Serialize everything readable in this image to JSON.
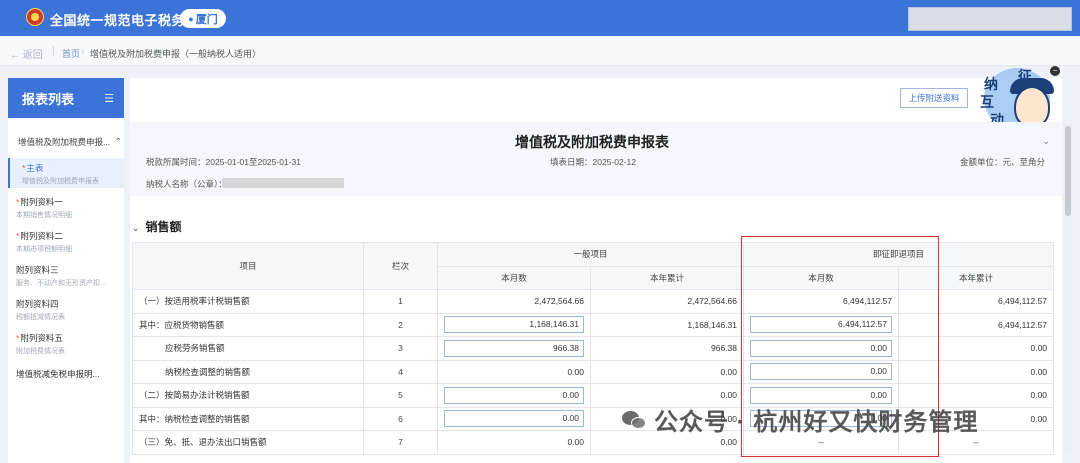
{
  "header": {
    "title": "全国统一规范电子税务局",
    "city": "厦门",
    "colors": {
      "brand": "#3b73d8",
      "highlight_border": "#d93636"
    }
  },
  "breadcrumb": {
    "back": "返回",
    "home": "首页",
    "current": "增值税及附加税费申报（一般纳税人适用）"
  },
  "sidebar": {
    "title": "报表列表",
    "group": "增值税及附加税费申报...",
    "items": [
      {
        "label": "主表",
        "sub": "增值税及附加税费申报表",
        "required": true,
        "active": true
      },
      {
        "label": "附列资料一",
        "sub": "本期销售情况明细",
        "required": true
      },
      {
        "label": "附列资料二",
        "sub": "本期进项税额明细",
        "required": true
      },
      {
        "label": "附列资料三",
        "sub": "服务、不动产和无形资产扣...",
        "required": false
      },
      {
        "label": "附列资料四",
        "sub": "税额抵减情况表",
        "required": false
      },
      {
        "label": "附列资料五",
        "sub": "附加税费情况表",
        "required": true
      },
      {
        "label": "增值税减免税申报明...",
        "sub": "",
        "required": false
      }
    ]
  },
  "main": {
    "upload_button": "上传附送资料",
    "mascot_text": [
      "征",
      "纳",
      "互",
      "动"
    ],
    "form_title": "增值税及附加税费申报表",
    "period_label": "税款所属时间：2025-01-01至2025-01-31",
    "fill_date_label": "填表日期：2025-02-12",
    "unit_label": "金额单位：元、至角分",
    "taxpayer_label": "纳税人名称（公章）：",
    "section_title": "销售额"
  },
  "table": {
    "headers": {
      "item": "项目",
      "column": "栏次",
      "general": "一般项目",
      "immediate": "即征即退项目",
      "month": "本月数",
      "ytd": "本年累计"
    },
    "rows": [
      {
        "label": "（一）按适用税率计税销售额",
        "col": "1",
        "g_month": "2,472,564.66",
        "g_ytd": "2,472,564.66",
        "i_month": "6,494,112.57",
        "i_ytd": "6,494,112.57",
        "g_input": false,
        "i_input": false
      },
      {
        "label": "其中：应税货物销售额",
        "col": "2",
        "g_month": "1,168,146.31",
        "g_ytd": "1,168,146.31",
        "i_month": "6,494,112.57",
        "i_ytd": "6,494,112.57",
        "g_input": true,
        "i_input": true
      },
      {
        "label": "应税劳务销售额",
        "col": "3",
        "g_month": "966.38",
        "g_ytd": "966.38",
        "i_month": "0.00",
        "i_ytd": "0.00",
        "g_input": true,
        "i_input": true,
        "indent": true
      },
      {
        "label": "纳税检查调整的销售额",
        "col": "4",
        "g_month": "0.00",
        "g_ytd": "0.00",
        "i_month": "0.00",
        "i_ytd": "0.00",
        "g_input": false,
        "i_input": true,
        "indent": true
      },
      {
        "label": "（二）按简易办法计税销售额",
        "col": "5",
        "g_month": "0.00",
        "g_ytd": "0.00",
        "i_month": "0.00",
        "i_ytd": "0.00",
        "g_input": true,
        "i_input": true
      },
      {
        "label": "其中：纳税检查调整的销售额",
        "col": "6",
        "g_month": "0.00",
        "g_ytd": "0.00",
        "i_month": "0.00",
        "i_ytd": "0.00",
        "g_input": true,
        "i_input": true
      },
      {
        "label": "（三）免、抵、退办法出口销售额",
        "col": "7",
        "g_month": "0.00",
        "g_ytd": "0.00",
        "i_month": "--",
        "i_ytd": "--",
        "g_input": false,
        "i_input": false
      }
    ]
  },
  "watermark": "公众号 · 杭州好又快财务管理"
}
